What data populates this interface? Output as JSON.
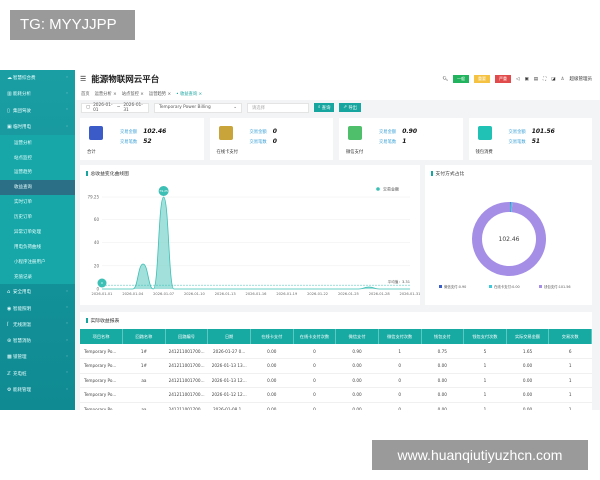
{
  "watermarks": {
    "top": "TG: MYYJJPP",
    "bottom": "www.huanqiutiyuzhcn.com"
  },
  "sidebar": {
    "items": [
      {
        "label": "智慧综合费",
        "icon": "cloud-icon"
      },
      {
        "label": "能耗分析",
        "icon": "bar-chart-icon"
      },
      {
        "label": "集团驾驶",
        "icon": "document-icon"
      },
      {
        "label": "临时用电",
        "icon": "calendar-icon",
        "expanded": true
      }
    ],
    "sub_items": [
      {
        "label": "运营分析"
      },
      {
        "label": "站点监控"
      },
      {
        "label": "运营趋势"
      },
      {
        "label": "收益查询",
        "active": true
      },
      {
        "label": "实时订单"
      },
      {
        "label": "历史订单"
      },
      {
        "label": "异常订单处理"
      },
      {
        "label": "用电负荷曲线"
      },
      {
        "label": "小程序注册用户"
      },
      {
        "label": "充值记录"
      }
    ],
    "items_after": [
      {
        "label": "安全用电",
        "icon": "shield-icon"
      },
      {
        "label": "智能照明",
        "icon": "bulb-icon"
      },
      {
        "label": "无线测温",
        "icon": "thermometer-icon"
      },
      {
        "label": "智慧消防",
        "icon": "fire-icon"
      },
      {
        "label": "锁管理",
        "icon": "lock-icon"
      },
      {
        "label": "充电桩",
        "icon": "charger-icon"
      },
      {
        "label": "能耗管理",
        "icon": "gear-icon"
      }
    ]
  },
  "header": {
    "title": "能源物联网云平台",
    "badges": [
      {
        "label": "一般",
        "color": "#22b35e"
      },
      {
        "label": "重要",
        "color": "#f5c242"
      },
      {
        "label": "严重",
        "color": "#e24b4b"
      }
    ],
    "user": "超级管理员"
  },
  "breadcrumbs": [
    "首页",
    "运营分析 ×",
    "站点监控 ×",
    "运营趋势 ×",
    "• 收益查询 ×"
  ],
  "filters": {
    "date_start": "2026-01-01",
    "date_sep": "~",
    "date_end": "2026-01-31",
    "billing": "Temporary Power Billing",
    "select_placeholder": "请选择",
    "query": "查询",
    "export": "导出"
  },
  "cards": [
    {
      "label": "合计",
      "amount_label": "交易金额",
      "amount": "102.46",
      "count_label": "交易笔数",
      "count": "52",
      "color": "#3b5bc9"
    },
    {
      "label": "在线卡支付",
      "amount_label": "交易金额",
      "amount": "0",
      "count_label": "交易笔数",
      "count": "0",
      "color": "#c9a43a"
    },
    {
      "label": "微信支付",
      "amount_label": "交易金额",
      "amount": "0.90",
      "count_label": "交易笔数",
      "count": "1",
      "color": "#4fbf6b"
    },
    {
      "label": "钱包消费",
      "amount_label": "交易金额",
      "amount": "101.56",
      "count_label": "交易笔数",
      "count": "51",
      "color": "#1fc2b5"
    }
  ],
  "chart_data": [
    {
      "type": "area",
      "title": "总收益变化曲线图",
      "legend": "交易金额",
      "legend_position": "top-right",
      "color": "#3cbfb5",
      "x": [
        "2026-01-01",
        "2026-01-02",
        "2026-01-03",
        "2026-01-04",
        "2026-01-05",
        "2026-01-06",
        "2026-01-07",
        "2026-01-08",
        "2026-01-09",
        "2026-01-10",
        "2026-01-11",
        "2026-01-12",
        "2026-01-13",
        "2026-01-14",
        "2026-01-15",
        "2026-01-16",
        "2026-01-17",
        "2026-01-18",
        "2026-01-19",
        "2026-01-20",
        "2026-01-21",
        "2026-01-22",
        "2026-01-23",
        "2026-01-24",
        "2026-01-25",
        "2026-01-26",
        "2026-01-27",
        "2026-01-28",
        "2026-01-29",
        "2026-01-30",
        "2026-01-31"
      ],
      "y": [
        0,
        0,
        0,
        0,
        21.56,
        0,
        79.25,
        0,
        0,
        0,
        0,
        0,
        0,
        0,
        0,
        0,
        0,
        0,
        0,
        0,
        0,
        0,
        0,
        0,
        0,
        0,
        1.65,
        0,
        0,
        0,
        0
      ],
      "xticks": [
        "2026-01-01",
        "2026-01-04",
        "2026-01-07",
        "2026-01-10",
        "2026-01-13",
        "2026-01-16",
        "2026-01-19",
        "2026-01-22",
        "2026-01-25",
        "2026-01-28",
        "2026-01-31"
      ],
      "yticks": [
        "0",
        "20",
        "40",
        "60",
        "79.25"
      ],
      "ylim": [
        0,
        79.25
      ],
      "max_label": "79.25",
      "min_label": "0",
      "average_label": "平均值：3.31",
      "average": 3.31,
      "grid": true
    },
    {
      "type": "pie",
      "title": "支付方式占比",
      "center_label": "102.46",
      "slices": [
        {
          "name": "微信支付:0.90",
          "value": 0.9,
          "color": "#3a5fc8"
        },
        {
          "name": "在线卡支付:0.00",
          "value": 0.0,
          "color": "#3ec9dc"
        },
        {
          "name": "钱包支付:101.56",
          "value": 101.56,
          "color": "#a58ee6"
        }
      ]
    }
  ],
  "table": {
    "title": "实际收益报表",
    "columns": [
      "项目名称",
      "回路名称",
      "回路编号",
      "日期",
      "在线卡支付",
      "在线卡支付次数",
      "微信支付",
      "微信支付次数",
      "钱包支付",
      "钱包支付次数",
      "实际交易金额",
      "交易次数"
    ],
    "rows": [
      [
        "Temporary Po...",
        "1#",
        "241211001700...",
        "2026-01-27 0...",
        "0.00",
        "0",
        "0.90",
        "1",
        "0.75",
        "5",
        "1.65",
        "6"
      ],
      [
        "Temporary Po...",
        "1#",
        "241211001700...",
        "2026-01-13 13...",
        "0.00",
        "0",
        "0.00",
        "0",
        "0.00",
        "1",
        "0.00",
        "1"
      ],
      [
        "Temporary Po...",
        "aa",
        "241211001700...",
        "2026-01-13 12...",
        "0.00",
        "0",
        "0.00",
        "0",
        "0.00",
        "1",
        "0.00",
        "1"
      ],
      [
        "Temporary Po...",
        "",
        "241211001700...",
        "2026-01-12 12...",
        "0.00",
        "0",
        "0.00",
        "0",
        "0.00",
        "1",
        "0.00",
        "1"
      ],
      [
        "Temporary Po...",
        "aa",
        "241211001700...",
        "2026-01-08 1...",
        "0.00",
        "0",
        "0.00",
        "0",
        "0.00",
        "1",
        "0.00",
        "1"
      ]
    ]
  }
}
